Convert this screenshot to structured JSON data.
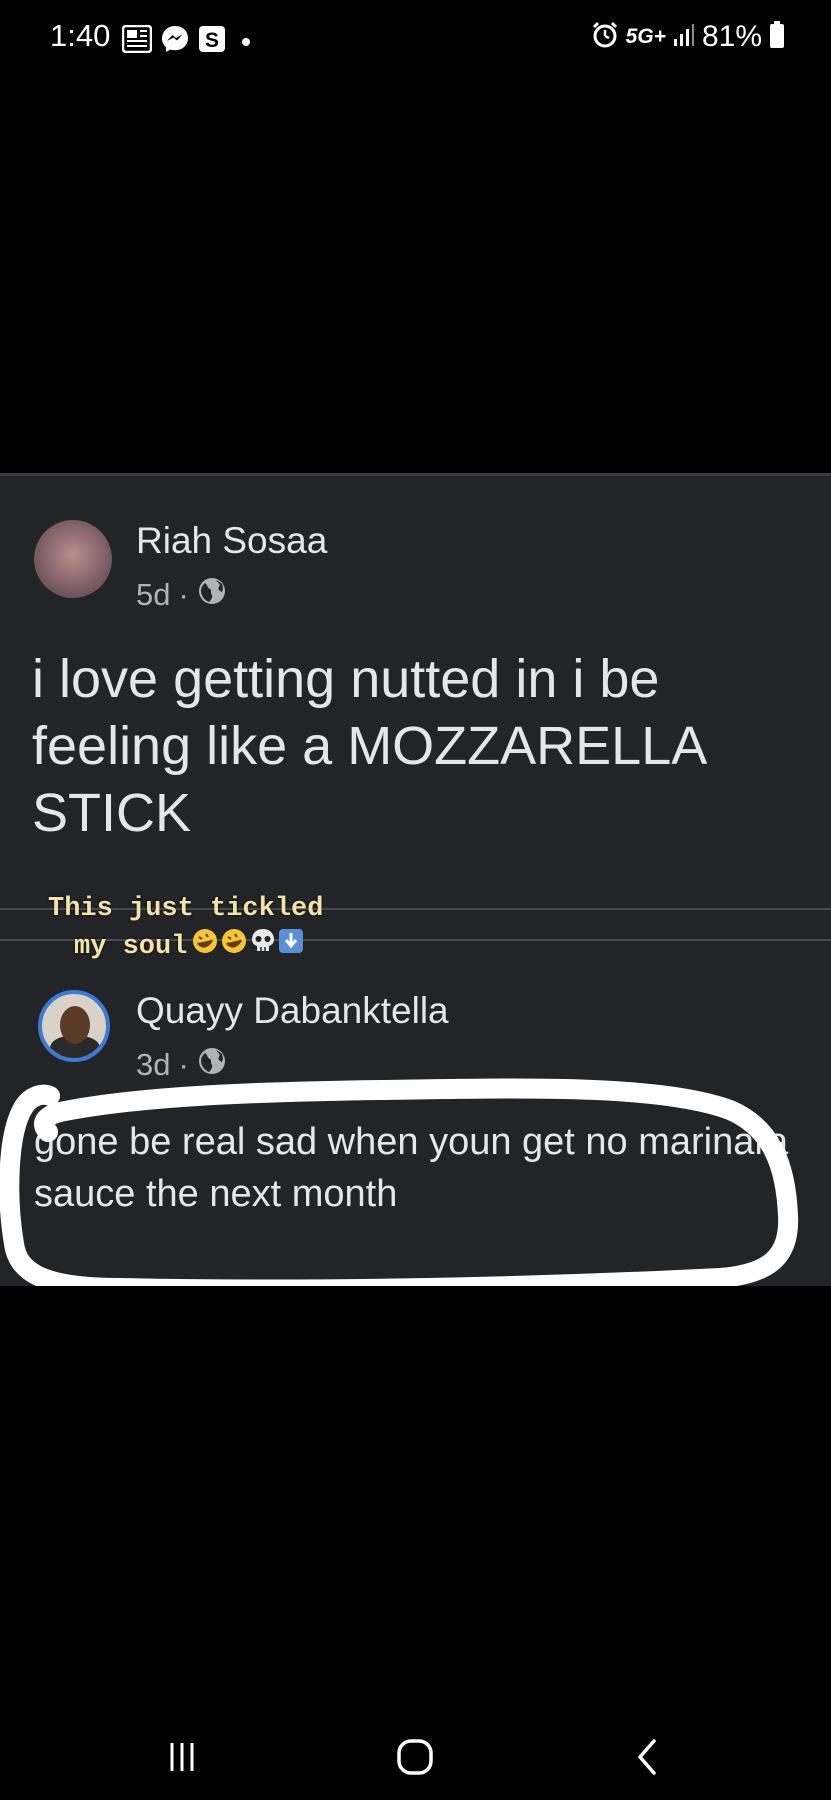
{
  "status_bar": {
    "time": "1:40",
    "left_icons": [
      "news-icon",
      "messenger-icon",
      "s-app-icon",
      "notification-dot"
    ],
    "network": "5G+",
    "battery": "81%"
  },
  "post": {
    "author": "Riah Sosaa",
    "age": "5d",
    "separator": "·",
    "privacy_icon": "globe-icon",
    "text": "i love getting nutted in i be feeling like a MOZZARELLA STICK"
  },
  "caption": {
    "line1": "This just tickled",
    "line2": "my soul",
    "emojis": [
      "rofl-emoji",
      "rofl-emoji",
      "skull-emoji",
      "down-arrow-emoji"
    ]
  },
  "comment": {
    "author": "Quayy Dabanktella",
    "age": "3d",
    "separator": "·",
    "privacy_icon": "globe-icon",
    "text": "gone be real sad when youn get no marinara sauce the next month"
  },
  "nav_bar": {
    "buttons": [
      "recents-icon",
      "home-icon",
      "back-icon"
    ]
  },
  "colors": {
    "background": "#000000",
    "card": "#232428",
    "text_primary": "#e4e6eb",
    "text_secondary": "#b0b3b8",
    "caption": "#f3e3a8",
    "avatar_ring": "#3c7ad6"
  }
}
